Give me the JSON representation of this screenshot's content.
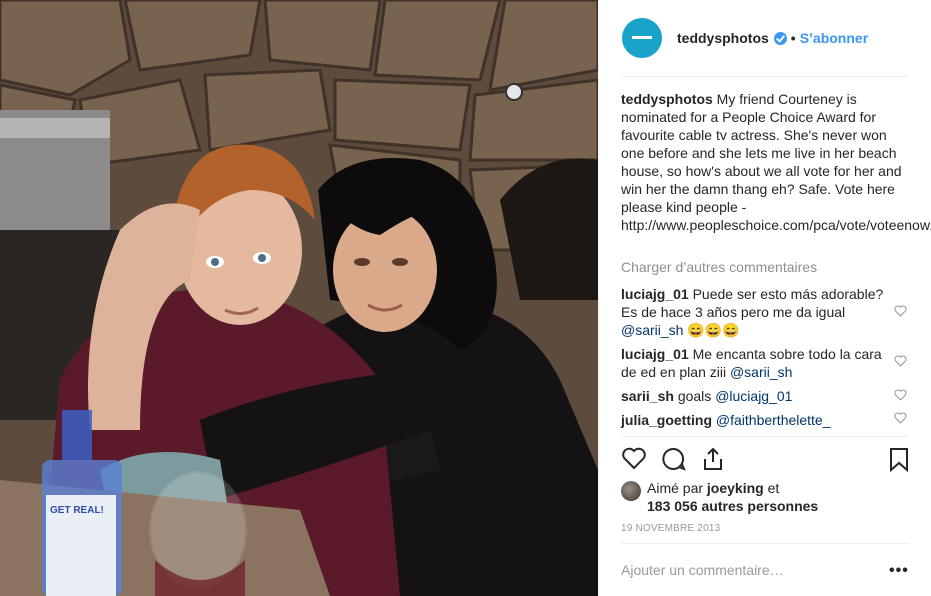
{
  "header": {
    "username": "teddysphotos",
    "dot": "•",
    "follow_label": "S’abonner"
  },
  "caption": {
    "username": "teddysphotos",
    "text": "My friend Courteney is nominated for a People Choice Award for favourite cable tv actress. She's never won one before and she lets me live in her beach house, so how's about we all vote for her and win her the damn thang eh? Safe. Vote here please kind people - http://www.peopleschoice.com/pca/vote/voteenow.jsp"
  },
  "load_more_label": "Charger d’autres commentaires",
  "comments": [
    {
      "username": "luciajg_01",
      "text": "Puede ser esto más adorable? Es de hace 3 años pero me da igual",
      "mention": "@sarii_sh",
      "emoji": "😄😄😄"
    },
    {
      "username": "luciajg_01",
      "text": "Me encanta sobre todo la cara de ed en plan ziii",
      "mention": "@sarii_sh"
    },
    {
      "username": "sarii_sh",
      "text": "goals",
      "mention": "@luciajg_01"
    },
    {
      "username": "julia_goetting",
      "mention": "@faithberthelette_"
    }
  ],
  "likes": {
    "prefix": "Aimé par",
    "liker": "joeyking",
    "connector": "et",
    "count_text": "183 056 autres personnes"
  },
  "date": "19 NOVEMBRE 2013",
  "add_comment_placeholder": "Ajouter un commentaire…",
  "more_label": "•••",
  "photo": {
    "bottle_label": "GET REAL!"
  },
  "colors": {
    "accent": "#3897f0",
    "mention": "#003569",
    "muted": "#8e8e8e",
    "avatar": "#1aa3c9"
  },
  "icons": [
    "verified-badge-icon",
    "heart-icon",
    "comment-icon",
    "share-icon",
    "bookmark-icon",
    "more-icon"
  ]
}
